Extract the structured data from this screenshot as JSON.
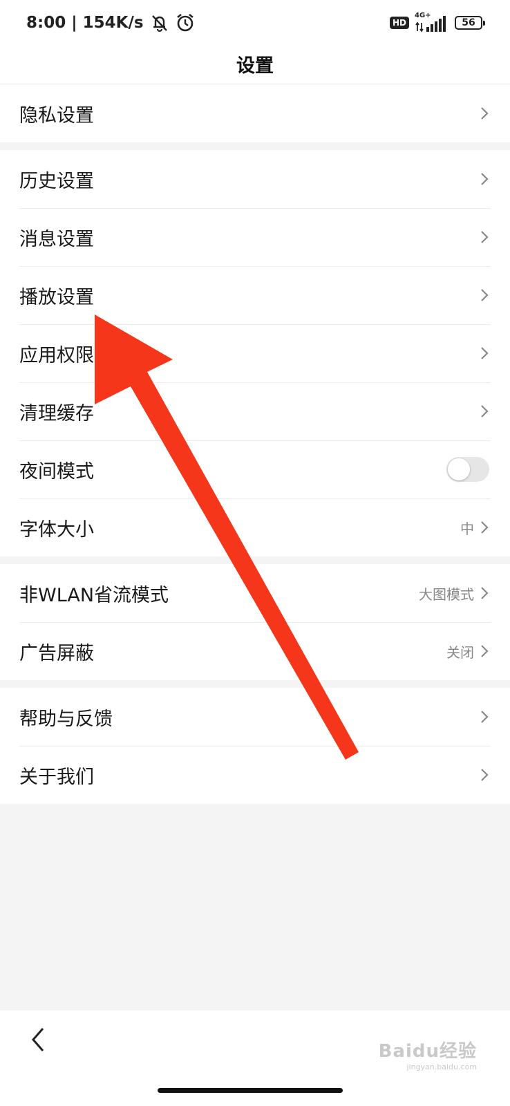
{
  "status_bar": {
    "time_speed": "8:00 | 154K/s",
    "icons": [
      "mute-icon",
      "alarm-icon"
    ],
    "hd_label": "HD",
    "network_label": "4G+",
    "battery_level": "56"
  },
  "header": {
    "title": "设置"
  },
  "groups": [
    {
      "items": [
        {
          "label": "隐私设置",
          "type": "link"
        }
      ]
    },
    {
      "items": [
        {
          "label": "历史设置",
          "type": "link"
        },
        {
          "label": "消息设置",
          "type": "link"
        },
        {
          "label": "播放设置",
          "type": "link"
        },
        {
          "label": "应用权限",
          "type": "link"
        },
        {
          "label": "清理缓存",
          "type": "link"
        },
        {
          "label": "夜间模式",
          "type": "toggle",
          "on": false
        },
        {
          "label": "字体大小",
          "type": "link",
          "value": "中"
        }
      ]
    },
    {
      "items": [
        {
          "label": "非WLAN省流模式",
          "type": "link",
          "value": "大图模式"
        },
        {
          "label": "广告屏蔽",
          "type": "link",
          "value": "关闭"
        }
      ]
    },
    {
      "items": [
        {
          "label": "帮助与反馈",
          "type": "link"
        },
        {
          "label": "关于我们",
          "type": "link"
        }
      ]
    }
  ],
  "bottom_nav": {
    "back_icon": "chevron-left-icon"
  },
  "watermark": {
    "logo": "Baidu经验",
    "url": "jingyan.baidu.com"
  },
  "colors": {
    "annotation_arrow": "#f5361a",
    "background": "#f4f4f4",
    "surface": "#ffffff"
  }
}
